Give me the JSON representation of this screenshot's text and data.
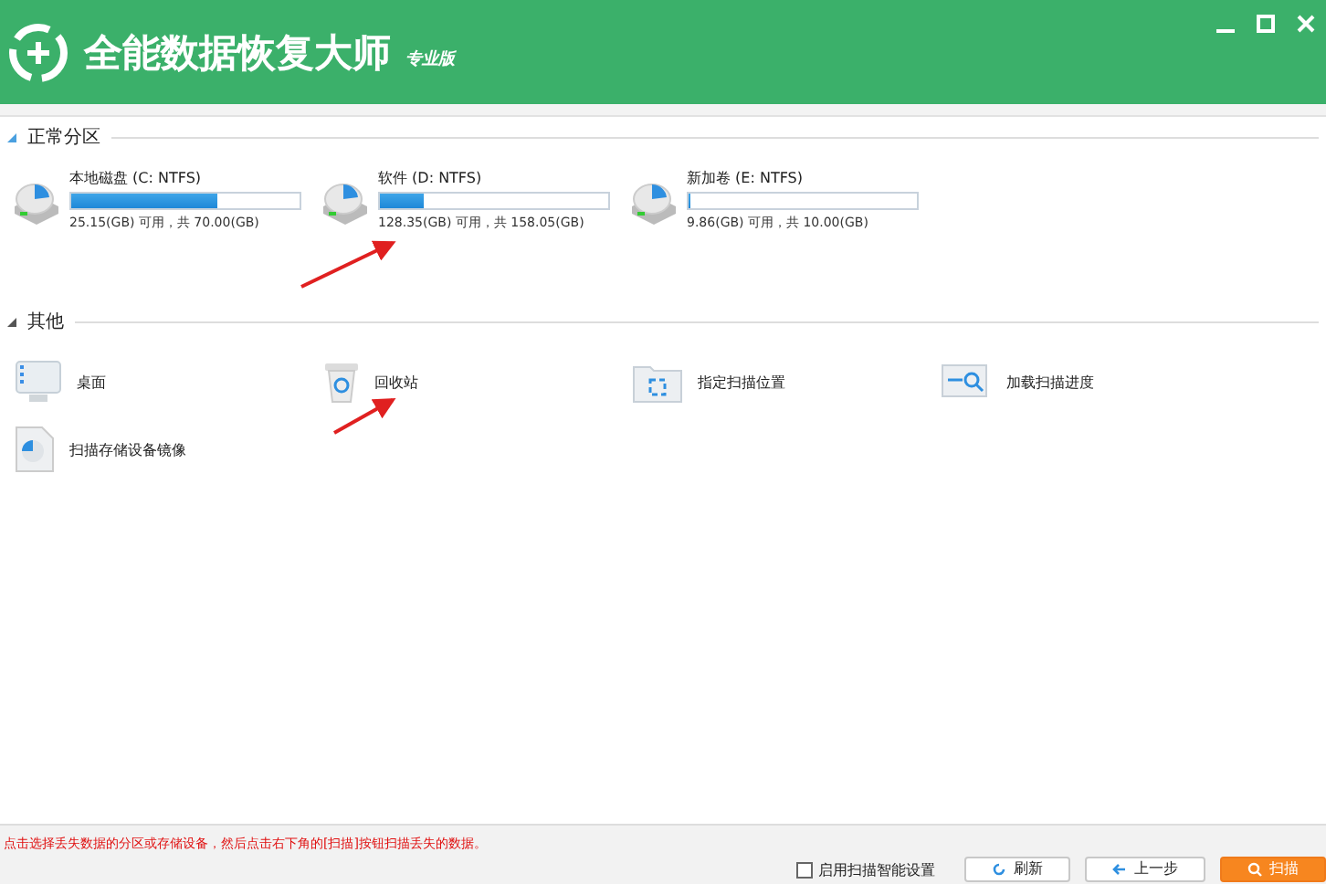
{
  "window": {
    "title": "全能数据恢复大师",
    "edition": "专业版"
  },
  "partitions": {
    "header": "正常分区",
    "drives": [
      {
        "name": "本地磁盘 (C: NTFS)",
        "level": 0.64,
        "usage": "25.15(GB) 可用，共 70.00(GB)"
      },
      {
        "name": "软件 (D: NTFS)",
        "level": 0.19,
        "usage": "128.35(GB) 可用，共 158.05(GB)"
      },
      {
        "name": "新加卷 (E: NTFS)",
        "level": 0.01,
        "usage": "9.86(GB) 可用，共 10.00(GB)"
      }
    ]
  },
  "others": {
    "header": "其他",
    "items": [
      {
        "kind": "desktop",
        "label": "桌面"
      },
      {
        "kind": "recycle",
        "label": "回收站"
      },
      {
        "kind": "folder",
        "label": "指定扫描位置"
      },
      {
        "kind": "progress",
        "label": "加载扫描进度"
      },
      {
        "kind": "image",
        "label": "扫描存储设备镜像"
      }
    ]
  },
  "status_bar": {
    "message": "点击选择丢失数据的分区或存储设备，然后点击右下角的[扫描]按钮扫描丢失的数据。",
    "checkbox": {
      "label": "启用扫描智能设置",
      "checked": false
    },
    "buttons": [
      {
        "kind": "refresh",
        "label": "刷新"
      },
      {
        "kind": "back",
        "label": "上一步"
      },
      {
        "kind": "scan",
        "label": "扫描"
      }
    ]
  }
}
